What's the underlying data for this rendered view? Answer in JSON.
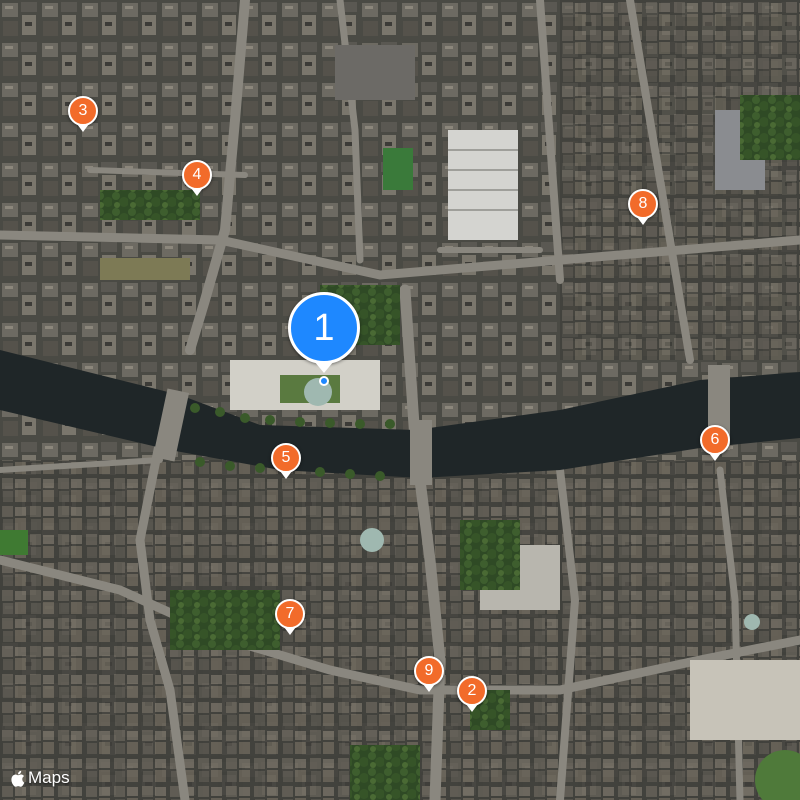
{
  "map": {
    "attribution": "Maps",
    "colors": {
      "water": "#1f2628",
      "pin_primary": "#1e88ff",
      "pin_secondary": "#f26b2a"
    },
    "pins": [
      {
        "label": "1",
        "kind": "primary"
      },
      {
        "label": "2",
        "kind": "secondary"
      },
      {
        "label": "3",
        "kind": "secondary"
      },
      {
        "label": "4",
        "kind": "secondary"
      },
      {
        "label": "5",
        "kind": "secondary"
      },
      {
        "label": "6",
        "kind": "secondary"
      },
      {
        "label": "7",
        "kind": "secondary"
      },
      {
        "label": "8",
        "kind": "secondary"
      },
      {
        "label": "9",
        "kind": "secondary"
      }
    ]
  }
}
